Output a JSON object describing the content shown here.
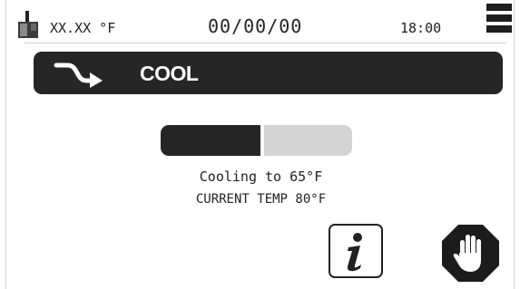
{
  "status_bar": {
    "temp": "XX.XX °F",
    "date": "00/00/00",
    "time": "18:00",
    "thermo_icon": "thermometer-icon",
    "menu_icon": "hamburger-menu-icon"
  },
  "mode": {
    "label": "COOL",
    "icon": "cool-flow-arrow-icon"
  },
  "progress": {
    "fraction": 0.52
  },
  "status": {
    "line1": "Cooling to 65°F",
    "line2": "CURRENT TEMP 80°F"
  },
  "actions": {
    "info_icon": "info-icon",
    "stop_icon": "stop-hand-icon"
  },
  "colors": {
    "dark": "#262626",
    "progress_rest": "#d4d4d4",
    "background": "#ffffff"
  }
}
